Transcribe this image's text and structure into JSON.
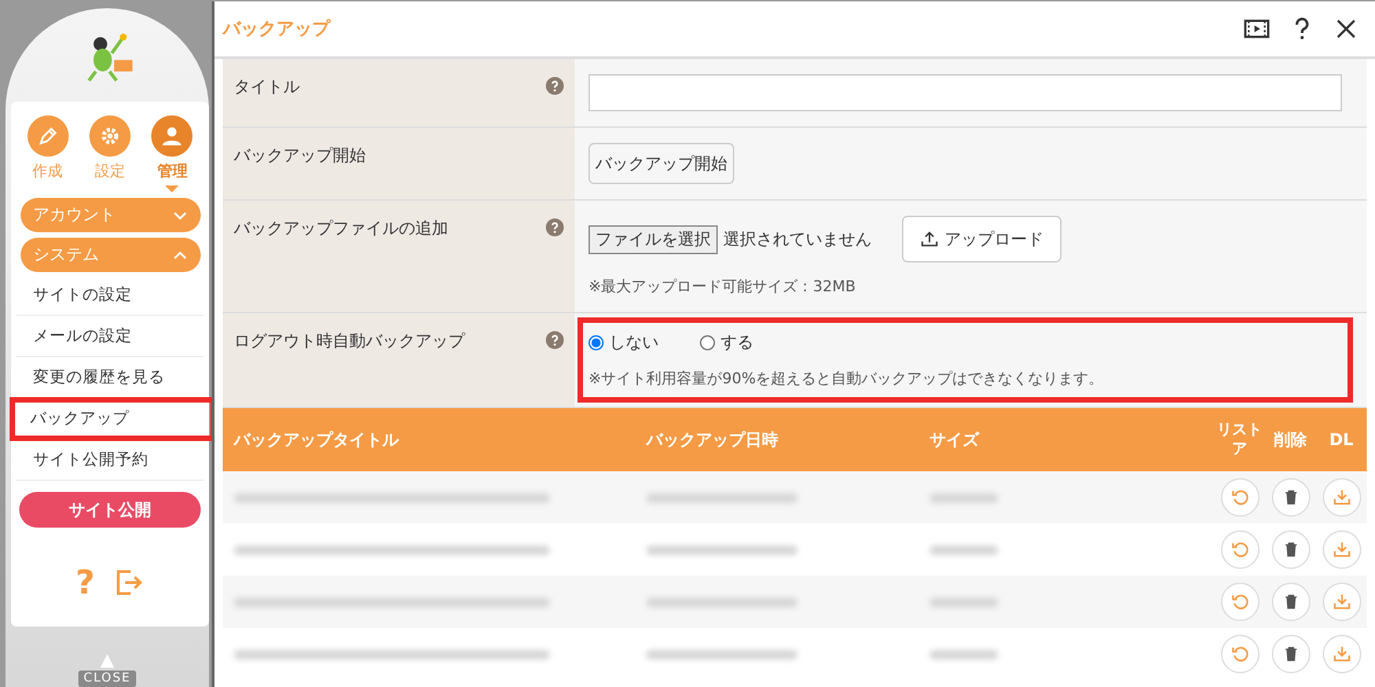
{
  "sidebar": {
    "nav": [
      {
        "label": "作成",
        "selected": false
      },
      {
        "label": "設定",
        "selected": false
      },
      {
        "label": "管理",
        "selected": true
      }
    ],
    "sections": [
      {
        "label": "アカウント",
        "expanded": false
      },
      {
        "label": "システム",
        "expanded": true,
        "items": [
          {
            "label": "サイトの設定",
            "highlighted": false
          },
          {
            "label": "メールの設定",
            "highlighted": false
          },
          {
            "label": "変更の履歴を見る",
            "highlighted": false
          },
          {
            "label": "バックアップ",
            "highlighted": true
          },
          {
            "label": "サイト公開予約",
            "highlighted": false
          }
        ]
      }
    ],
    "publish_button": "サイト公開",
    "help_icon": "?",
    "close_label": "CLOSE"
  },
  "dialog": {
    "title": "バックアップ",
    "form": [
      {
        "kind": "text",
        "label": "タイトル",
        "help": true,
        "highlighted": false
      },
      {
        "kind": "button",
        "label": "バックアップ開始",
        "help": false,
        "button": "バックアップ開始",
        "highlighted": false
      },
      {
        "kind": "file",
        "label": "バックアップファイルの追加",
        "help": true,
        "file_button": "ファイルを選択",
        "file_status": "選択されていません",
        "upload_button": "アップロード",
        "note": "※最大アップロード可能サイズ：32MB",
        "highlighted": false
      },
      {
        "kind": "radio",
        "label": "ログアウト時自動バックアップ",
        "help": true,
        "options": [
          {
            "label": "しない",
            "selected": true
          },
          {
            "label": "する",
            "selected": false
          }
        ],
        "note": "※サイト利用容量が90%を超えると自動バックアップはできなくなります。",
        "highlighted": true
      }
    ],
    "table": {
      "columns": [
        "バックアップタイトル",
        "バックアップ日時",
        "サイズ",
        "リストア",
        "削除",
        "DL"
      ],
      "rows": [
        {
          "kind": "blurred"
        },
        {
          "kind": "blurred"
        },
        {
          "kind": "blurred"
        },
        {
          "kind": "blurred"
        }
      ]
    }
  }
}
